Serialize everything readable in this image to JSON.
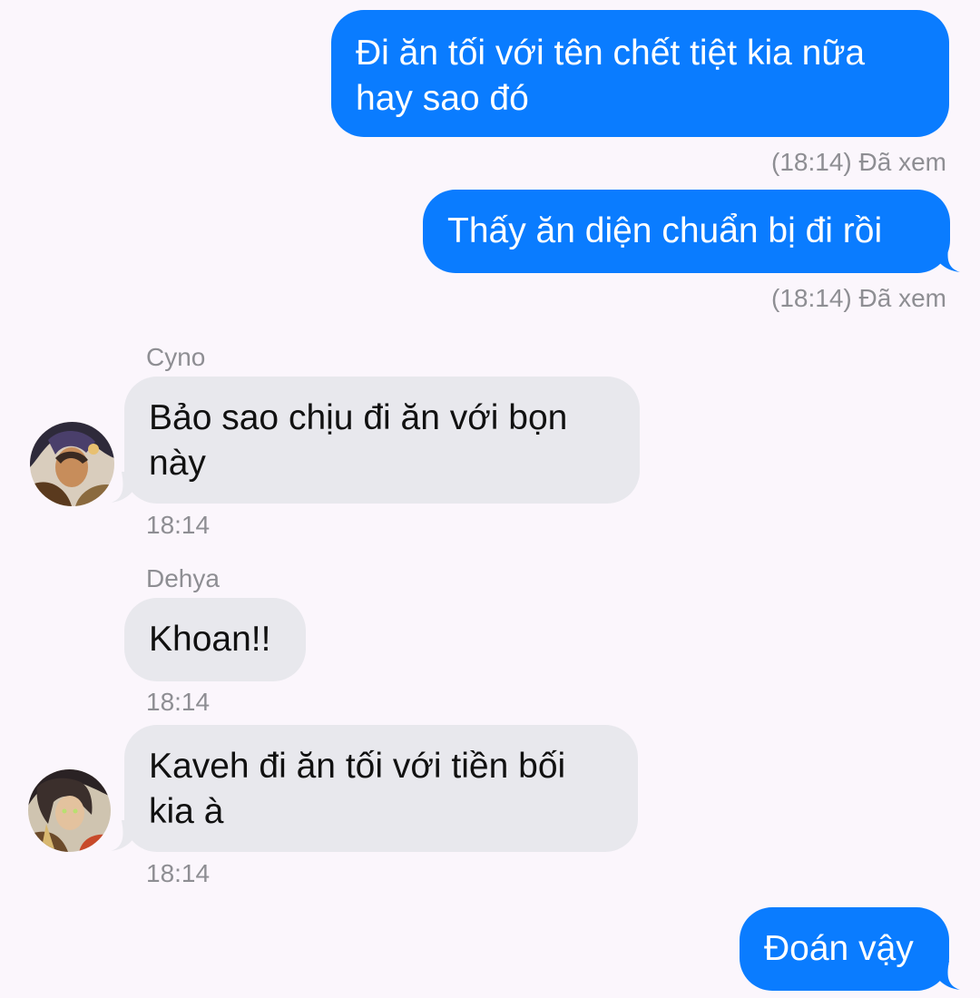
{
  "messages": [
    {
      "type": "out",
      "text": "Đi ăn tối với tên chết tiệt kia nữa\nhay sao đó",
      "status": "(18:14) Đã xem"
    },
    {
      "type": "out",
      "text": "Thấy ăn diện chuẩn bị đi rồi",
      "status": "(18:14) Đã xem"
    },
    {
      "type": "in",
      "sender": "Cyno",
      "text": "Bảo sao chịu đi ăn với bọn\nnày",
      "time": "18:14",
      "avatar": "cyno-avatar"
    },
    {
      "type": "in",
      "sender": "Dehya",
      "text": "Khoan!!",
      "time": "18:14"
    },
    {
      "type": "in",
      "text": "Kaveh đi ăn tối với tiền bối\nkia à",
      "time": "18:14",
      "avatar": "dehya-avatar"
    },
    {
      "type": "out",
      "text": "Đoán vậy"
    }
  ],
  "colors": {
    "background": "#fbf6fc",
    "outgoing_bubble": "#0a7cff",
    "incoming_bubble": "#e8e8ed",
    "meta_text": "#8e8e93"
  }
}
